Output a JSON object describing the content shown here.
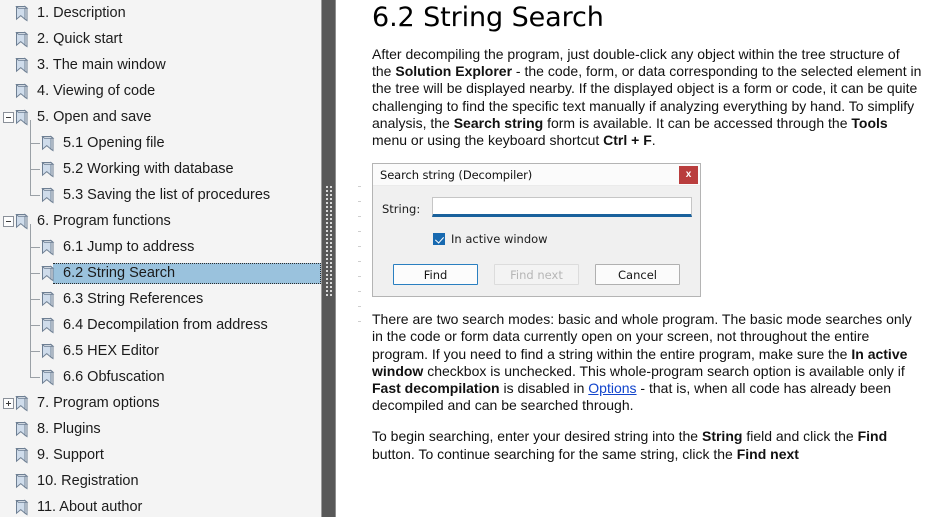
{
  "sidebar": {
    "items": [
      {
        "label": "1. Description",
        "level": 0,
        "expander": "none",
        "selected": false,
        "icon": "bookmark-icon"
      },
      {
        "label": "2. Quick start",
        "level": 0,
        "expander": "none",
        "selected": false,
        "icon": "bookmark-icon"
      },
      {
        "label": "3. The main window",
        "level": 0,
        "expander": "none",
        "selected": false,
        "icon": "bookmark-icon"
      },
      {
        "label": "4. Viewing of code",
        "level": 0,
        "expander": "none",
        "selected": false,
        "icon": "bookmark-icon"
      },
      {
        "label": "5. Open and save",
        "level": 0,
        "expander": "minus",
        "selected": false,
        "icon": "bookmark-icon"
      },
      {
        "label": "5.1 Opening file",
        "level": 1,
        "expander": "none",
        "selected": false,
        "icon": "bookmark-icon"
      },
      {
        "label": "5.2 Working with database",
        "level": 1,
        "expander": "none",
        "selected": false,
        "icon": "bookmark-icon"
      },
      {
        "label": "5.3 Saving the list of procedures",
        "level": 1,
        "expander": "none",
        "selected": false,
        "icon": "bookmark-icon"
      },
      {
        "label": "6. Program functions",
        "level": 0,
        "expander": "minus",
        "selected": false,
        "icon": "bookmark-icon"
      },
      {
        "label": "6.1 Jump to address",
        "level": 1,
        "expander": "none",
        "selected": false,
        "icon": "bookmark-icon"
      },
      {
        "label": "6.2 String Search",
        "level": 1,
        "expander": "none",
        "selected": true,
        "icon": "bookmark-icon"
      },
      {
        "label": "6.3 String References",
        "level": 1,
        "expander": "none",
        "selected": false,
        "icon": "bookmark-icon"
      },
      {
        "label": "6.4 Decompilation from address",
        "level": 1,
        "expander": "none",
        "selected": false,
        "icon": "bookmark-icon"
      },
      {
        "label": "6.5 HEX Editor",
        "level": 1,
        "expander": "none",
        "selected": false,
        "icon": "bookmark-icon"
      },
      {
        "label": "6.6 Obfuscation",
        "level": 1,
        "expander": "none",
        "selected": false,
        "icon": "bookmark-icon"
      },
      {
        "label": "7. Program options",
        "level": 0,
        "expander": "plus",
        "selected": false,
        "icon": "bookmark-icon"
      },
      {
        "label": "8. Plugins",
        "level": 0,
        "expander": "none",
        "selected": false,
        "icon": "bookmark-icon"
      },
      {
        "label": "9. Support",
        "level": 0,
        "expander": "none",
        "selected": false,
        "icon": "bookmark-icon"
      },
      {
        "label": "10. Registration",
        "level": 0,
        "expander": "none",
        "selected": false,
        "icon": "bookmark-icon"
      },
      {
        "label": "11. About author",
        "level": 0,
        "expander": "none",
        "selected": false,
        "icon": "bookmark-icon"
      }
    ],
    "colors": {
      "pane_background": "#f4f4f4",
      "selection": "#9ac2dd",
      "splitter": "#585858"
    }
  },
  "content": {
    "title": "6.2 String Search",
    "paragraph1": {
      "parts": [
        {
          "text": "After decompiling the program, just double-click any object within the tree structure of the ",
          "style": "normal"
        },
        {
          "text": "Solution Explorer",
          "style": "bold"
        },
        {
          "text": " - the code, form, or data corresponding to the selected element in the tree will be displayed nearby. If the displayed object is a form or code, it can be quite challenging to find the specific text manually if analyzing everything by hand. To simplify analysis, the ",
          "style": "normal"
        },
        {
          "text": "Search string",
          "style": "bold"
        },
        {
          "text": " form is available. It can be accessed through the ",
          "style": "normal"
        },
        {
          "text": "Tools",
          "style": "bold"
        },
        {
          "text": " menu or using the keyboard shortcut ",
          "style": "normal"
        },
        {
          "text": "Ctrl + F",
          "style": "bold"
        },
        {
          "text": ".",
          "style": "normal"
        }
      ]
    },
    "paragraph2": {
      "parts": [
        {
          "text": "There are two search modes: basic and whole program. The basic mode searches only in the code or form data currently open on your screen, not throughout the entire program. If you need to find a string within the entire program, make sure the ",
          "style": "normal"
        },
        {
          "text": "In active window",
          "style": "bold"
        },
        {
          "text": " checkbox is unchecked. This whole-program search option is available only if ",
          "style": "normal"
        },
        {
          "text": "Fast decompilation",
          "style": "bold"
        },
        {
          "text": " is disabled in ",
          "style": "normal"
        },
        {
          "text": "Options",
          "style": "link"
        },
        {
          "text": " - that is, when all code has already been decompiled and can be searched through.",
          "style": "normal"
        }
      ]
    },
    "paragraph3": {
      "parts": [
        {
          "text": "To begin searching, enter your desired string into the ",
          "style": "normal"
        },
        {
          "text": "String",
          "style": "bold"
        },
        {
          "text": " field and click the ",
          "style": "normal"
        },
        {
          "text": "Find",
          "style": "bold"
        },
        {
          "text": " button. To continue searching for the same string, click the ",
          "style": "normal"
        },
        {
          "text": "Find next",
          "style": "bold"
        }
      ]
    },
    "link_color": "#1144cc"
  },
  "dialog": {
    "title": "Search string (Decompiler)",
    "close_label": "x",
    "close_color": "#b93d3d",
    "string_label": "String:",
    "string_value": "",
    "checkbox_label": "In active window",
    "checkbox_checked": true,
    "checkbox_color": "#1769b0",
    "buttons": [
      {
        "label": "Find",
        "state": "default"
      },
      {
        "label": "Find next",
        "state": "disabled"
      },
      {
        "label": "Cancel",
        "state": "normal"
      }
    ]
  }
}
